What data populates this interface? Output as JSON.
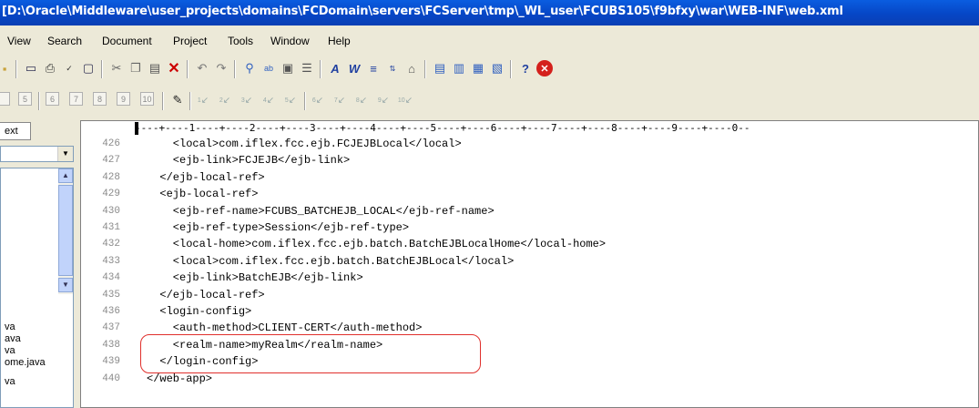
{
  "window": {
    "title": "[D:\\Oracle\\Middleware\\user_projects\\domains\\FCDomain\\servers\\FCServer\\tmp\\_WL_user\\FCUBS105\\f9bfxy\\war\\WEB-INF\\web.xml"
  },
  "menu": [
    "View",
    "Search",
    "Document",
    "Project",
    "Tools",
    "Window",
    "Help"
  ],
  "toolbar1": [
    {
      "icon": "folder-icon"
    },
    {
      "icon": "print-preview-icon"
    },
    {
      "icon": "print-icon"
    },
    {
      "icon": "spellcheck-icon"
    },
    {
      "icon": "page-icon"
    },
    {
      "icon": "cut-icon"
    },
    {
      "icon": "copy-icon"
    },
    {
      "icon": "paste-icon"
    },
    {
      "icon": "delete-icon"
    },
    {
      "icon": "undo-icon"
    },
    {
      "icon": "redo-icon"
    },
    {
      "icon": "find-icon"
    },
    {
      "icon": "replace-icon"
    },
    {
      "icon": "goto-icon"
    },
    {
      "icon": "indent-icon"
    },
    {
      "icon": "font-icon"
    },
    {
      "icon": "bold-font-icon"
    },
    {
      "icon": "wrap-icon"
    },
    {
      "icon": "sort-icon"
    },
    {
      "icon": "properties-icon"
    },
    {
      "icon": "view1-icon"
    },
    {
      "icon": "view2-icon"
    },
    {
      "icon": "view3-icon"
    },
    {
      "icon": "view4-icon"
    },
    {
      "icon": "help-icon"
    },
    {
      "icon": "close-icon"
    }
  ],
  "toolbar2": {
    "number_buttons": [
      "5",
      "6",
      "7",
      "8",
      "9",
      "10"
    ],
    "marker_labels": [
      "1",
      "2",
      "3",
      "4",
      "5",
      "6",
      "7",
      "8",
      "9",
      "10"
    ]
  },
  "left_panel": {
    "tab_label": "ext",
    "files": [
      "va",
      "ava",
      "va",
      "ome.java",
      "va"
    ]
  },
  "editor": {
    "ruler": "----+----1----+----2----+----3----+----4----+----5----+----6----+----7----+----8----+----9----+----0--",
    "lines": [
      {
        "no": "426",
        "text": "    <local>com.iflex.fcc.ejb.FCJEJBLocal</local>"
      },
      {
        "no": "427",
        "text": "    <ejb-link>FCJEJB</ejb-link>"
      },
      {
        "no": "428",
        "text": "  </ejb-local-ref>"
      },
      {
        "no": "429",
        "text": "  <ejb-local-ref>"
      },
      {
        "no": "430",
        "text": "    <ejb-ref-name>FCUBS_BATCHEJB_LOCAL</ejb-ref-name>"
      },
      {
        "no": "431",
        "text": "    <ejb-ref-type>Session</ejb-ref-type>"
      },
      {
        "no": "432",
        "text": "    <local-home>com.iflex.fcc.ejb.batch.BatchEJBLocalHome</local-home>"
      },
      {
        "no": "433",
        "text": "    <local>com.iflex.fcc.ejb.batch.BatchEJBLocal</local>"
      },
      {
        "no": "434",
        "text": "    <ejb-link>BatchEJB</ejb-link>"
      },
      {
        "no": "435",
        "text": "  </ejb-local-ref>"
      },
      {
        "no": "436",
        "text": "  <login-config>"
      },
      {
        "no": "437",
        "text": "    <auth-method>CLIENT-CERT</auth-method>"
      },
      {
        "no": "438",
        "text": "    <realm-name>myRealm</realm-name>"
      },
      {
        "no": "439",
        "text": "  </login-config>"
      },
      {
        "no": "440",
        "text": "</web-app>"
      }
    ]
  },
  "colors": {
    "highlight": "#e0302c",
    "titlebar": "#0646c6"
  }
}
